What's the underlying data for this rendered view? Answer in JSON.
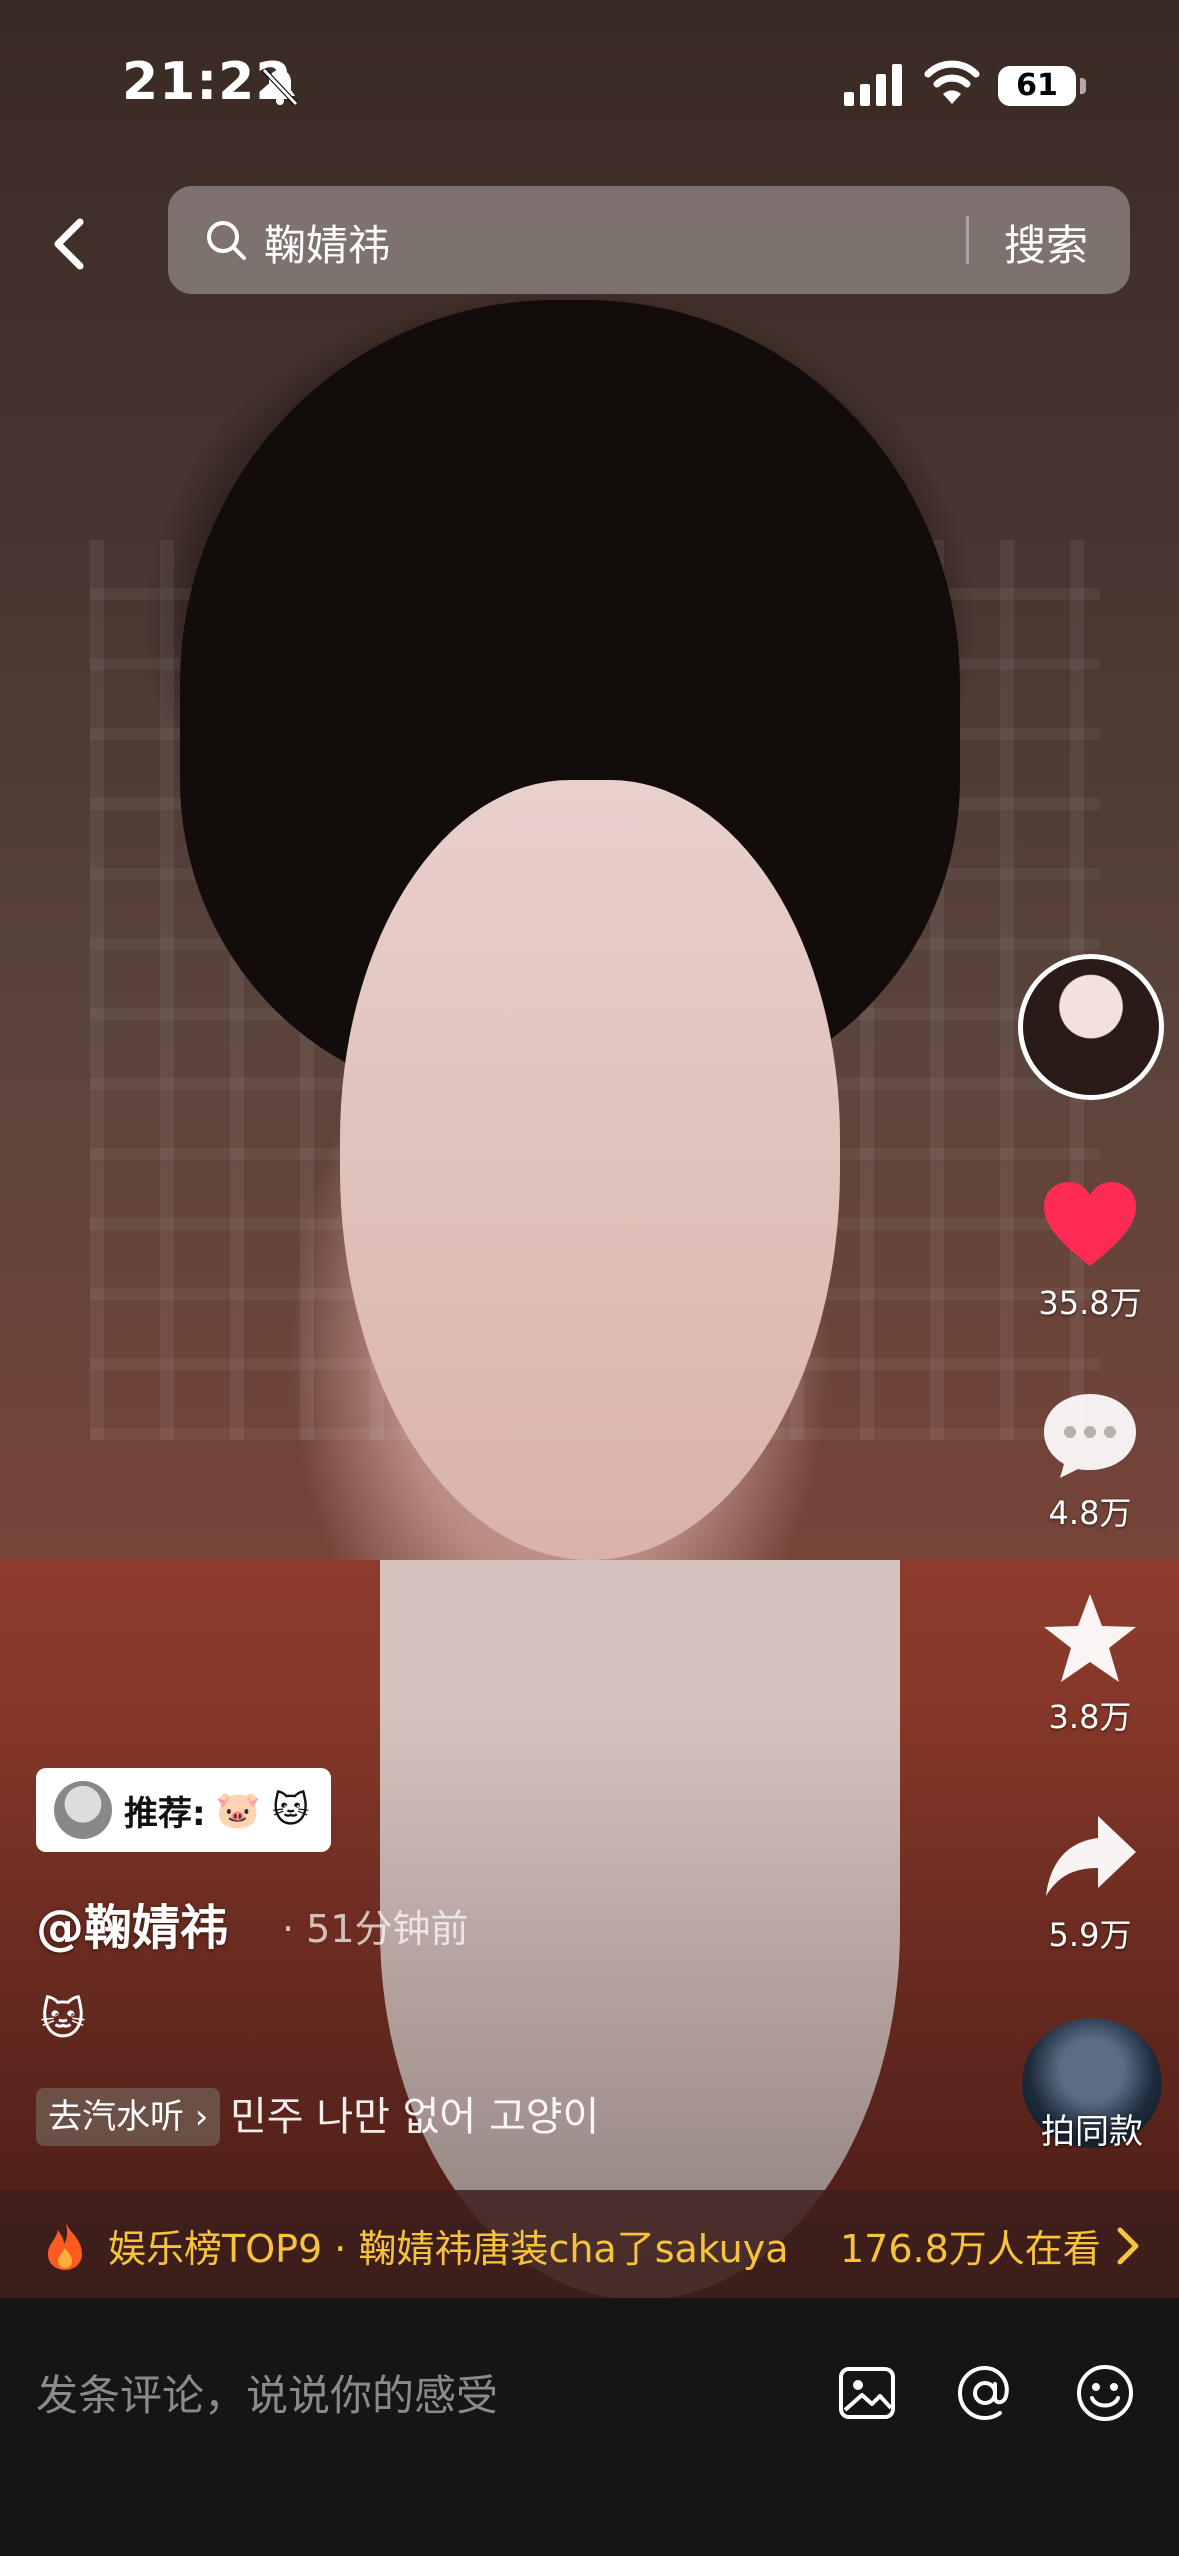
{
  "status_bar": {
    "time": "21:22",
    "battery": "61"
  },
  "search": {
    "query": "鞠婧祎",
    "button_label": "搜索"
  },
  "rail": {
    "likes": "35.8万",
    "comments": "4.8万",
    "favorites": "3.8万",
    "shares": "5.9万",
    "remix_label": "拍同款"
  },
  "post": {
    "recommend_label": "推荐: ",
    "recommend_emoji": "🐷 🐱",
    "username": "@鞠婧祎",
    "time_ago": "· 51分钟前",
    "caption_emoji": "🐱",
    "music_chip": "去汽水听 ›",
    "music_text": "민주   나만 없어 고양이"
  },
  "trending": {
    "text": "娱乐榜TOP9 · 鞠婧祎唐装cha了sakuya",
    "views": "176.8万人在看"
  },
  "comment_bar": {
    "placeholder": "发条评论，说说你的感受"
  },
  "colors": {
    "like_red": "#fe2c55",
    "trend_yellow": "#f7c33b",
    "comment_bar_bg": "#151515"
  },
  "icons": [
    "back-arrow-icon",
    "search-icon",
    "heart-icon",
    "comment-icon",
    "star-icon",
    "share-icon",
    "fire-icon",
    "image-icon",
    "at-icon",
    "emoji-icon",
    "bell-muted-icon",
    "signal-icon",
    "wifi-icon"
  ]
}
